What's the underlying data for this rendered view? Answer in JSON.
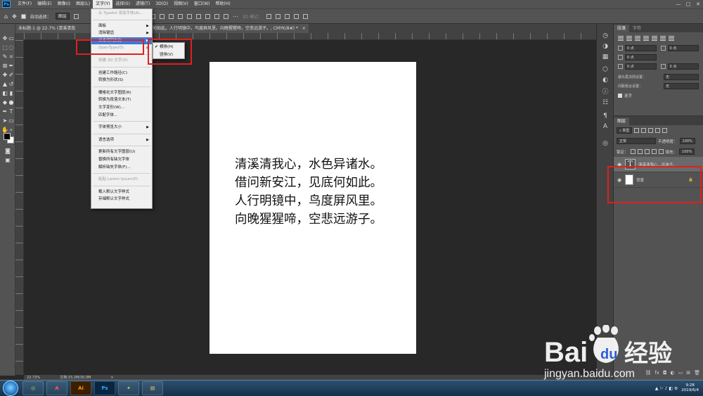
{
  "menubar": {
    "logo": "Ps",
    "items": [
      "文件(F)",
      "编辑(E)",
      "图像(I)",
      "图层(L)",
      "文字(Y)",
      "选择(S)",
      "滤镜(T)",
      "3D(D)",
      "视图(V)",
      "窗口(W)",
      "帮助(H)"
    ],
    "active_index": 4,
    "window_controls": [
      "—",
      "□",
      "✕"
    ]
  },
  "options_bar": {
    "auto_select_label": "自动选择：",
    "auto_select_value": "图层",
    "mode_3d": "3D 模式："
  },
  "document_tab": {
    "title": "未标题-1 @ 22.7% (清溪清我",
    "title_rest": "见底何如此。人行明镜中，鸟度屏风里。向晚猩猩啼，空悲远游子。, CMYK/8#) *",
    "close": "×"
  },
  "type_menu": {
    "items": [
      {
        "label": "从 Typekit 添加字体(A)...",
        "disabled": true
      },
      {
        "sep": true
      },
      {
        "label": "面板",
        "submenu": true
      },
      {
        "label": "消除锯齿",
        "submenu": true
      },
      {
        "label": "文本排列方向",
        "submenu": true,
        "highlight": true
      },
      {
        "label": "OpenType(O)",
        "disabled": true,
        "submenu": true
      },
      {
        "sep": true
      },
      {
        "label": "创建 3D 文字(D)",
        "disabled": true
      },
      {
        "sep": true
      },
      {
        "label": "创建工作路径(C)"
      },
      {
        "label": "转换为形状(S)"
      },
      {
        "sep": true
      },
      {
        "label": "栅格化文字图层(R)"
      },
      {
        "label": "转换为段落文本(T)"
      },
      {
        "label": "文字变形(W)..."
      },
      {
        "label": "匹配字体..."
      },
      {
        "sep": true
      },
      {
        "label": "字体预览大小",
        "submenu": true
      },
      {
        "sep": true
      },
      {
        "label": "语言选项",
        "submenu": true
      },
      {
        "sep": true
      },
      {
        "label": "更新所有文字图层(U)"
      },
      {
        "label": "替换所有缺欠字体"
      },
      {
        "label": "解析缺失字体(F)..."
      },
      {
        "sep": true
      },
      {
        "label": "粘贴 Lorem Ipsum(P)",
        "disabled": true
      },
      {
        "sep": true
      },
      {
        "label": "载入默认文字样式"
      },
      {
        "label": "存储默认文字样式"
      }
    ]
  },
  "orientation_submenu": {
    "items": [
      {
        "label": "横排(H)",
        "checked": true
      },
      {
        "label": "竖排(V)",
        "checked": false
      }
    ],
    "check_glyph": "✔"
  },
  "canvas": {
    "poem_lines": [
      "清溪清我心，水色异诸水。",
      "借问新安江，见底何如此。",
      "人行明镜中，鸟度屏风里。",
      "向晚猩猩啼，空悲远游子。"
    ]
  },
  "status_bar": {
    "zoom": "22.73%",
    "doc_info": "文档:33.2M/30.0M",
    "arrow": ">"
  },
  "paragraph_panel": {
    "tabs": [
      "段落",
      "字符"
    ],
    "active_tab": 0,
    "fields": [
      "0 点",
      "0 点",
      "0 点",
      "0 点",
      "0 点"
    ],
    "kinsoku_label": "避头尾法则设置：",
    "kinsoku_value": "无",
    "mojikumi_label": "间距组合设置：",
    "mojikumi_value": "无",
    "hyphenate_label": "连字"
  },
  "layers_panel": {
    "title": "图层",
    "filter_label": "类型",
    "blend_mode": "正常",
    "opacity_label": "不透明度：",
    "opacity_value": "100%",
    "lock_label": "锁定：",
    "fill_label": "填充：",
    "fill_value": "100%",
    "layers": [
      {
        "name": "清溪清我心...远游子。",
        "type": "text",
        "thumb": "T",
        "selected": true
      },
      {
        "name": "背景",
        "type": "background",
        "selected": false
      }
    ],
    "footer_icons": [
      "link-icon",
      "fx-icon",
      "mask-icon",
      "adjustment-icon",
      "group-icon",
      "new-layer-icon",
      "trash-icon"
    ],
    "footer_glyphs": [
      "⛓",
      "fx",
      "◘",
      "◐",
      "▭",
      "⊞",
      "🗑"
    ]
  },
  "taskbar": {
    "apps": [
      {
        "name": "chrome",
        "label": "◎"
      },
      {
        "name": "acrobat",
        "label": "A"
      },
      {
        "name": "illustrator",
        "label": "Ai"
      },
      {
        "name": "photoshop",
        "label": "Ps"
      },
      {
        "name": "app5",
        "label": "✦"
      },
      {
        "name": "explorer",
        "label": "▤"
      }
    ],
    "time": "9:28",
    "date": "2019/6/4",
    "tray_glyphs": "▲ ⚐ ♪ ◧ ⚙"
  },
  "watermark": {
    "brand": "Bai",
    "brand_cn": "经验",
    "url": "jingyan.baidu.com"
  },
  "colors": {
    "menu_highlight": "#3b78d8",
    "annotation_red": "#e0201c",
    "ps_blue": "#31a8ff",
    "baidu_red": "#e02020",
    "baidu_blue": "#2b5fd9"
  }
}
